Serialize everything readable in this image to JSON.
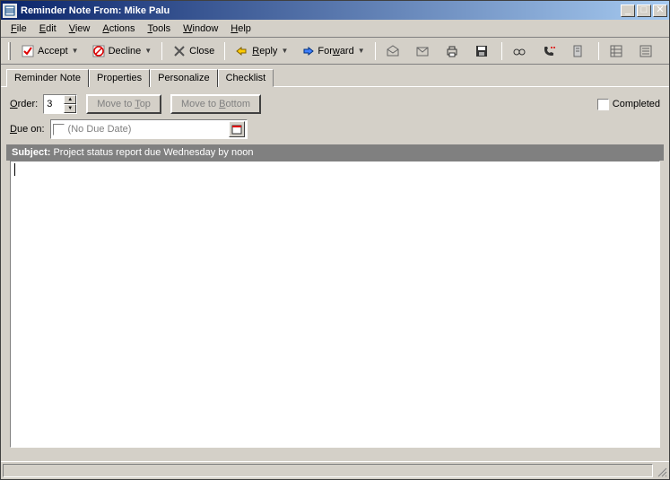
{
  "window": {
    "title": "Reminder Note From: Mike Palu"
  },
  "menu": {
    "file": "File",
    "edit": "Edit",
    "view": "View",
    "actions": "Actions",
    "tools": "Tools",
    "window": "Window",
    "help": "Help"
  },
  "toolbar": {
    "accept": "Accept",
    "decline": "Decline",
    "close": "Close",
    "reply": "Reply",
    "forward": "Forward"
  },
  "tabs": {
    "reminder": "Reminder Note",
    "properties": "Properties",
    "personalize": "Personalize",
    "checklist": "Checklist"
  },
  "checklist": {
    "order_label_pre": "O",
    "order_label_post": "rder:",
    "order_value": "3",
    "move_top_pre": "Move to ",
    "move_top_u": "T",
    "move_top_post": "op",
    "move_bottom_pre": "Move to ",
    "move_bottom_u": "B",
    "move_bottom_post": "ottom",
    "completed_label": "Completed",
    "due_label_pre": "D",
    "due_label_post": "ue on:",
    "due_placeholder": "(No Due Date)"
  },
  "subject": {
    "label": "Subject:",
    "text": "Project status report due Wednesday by noon"
  }
}
